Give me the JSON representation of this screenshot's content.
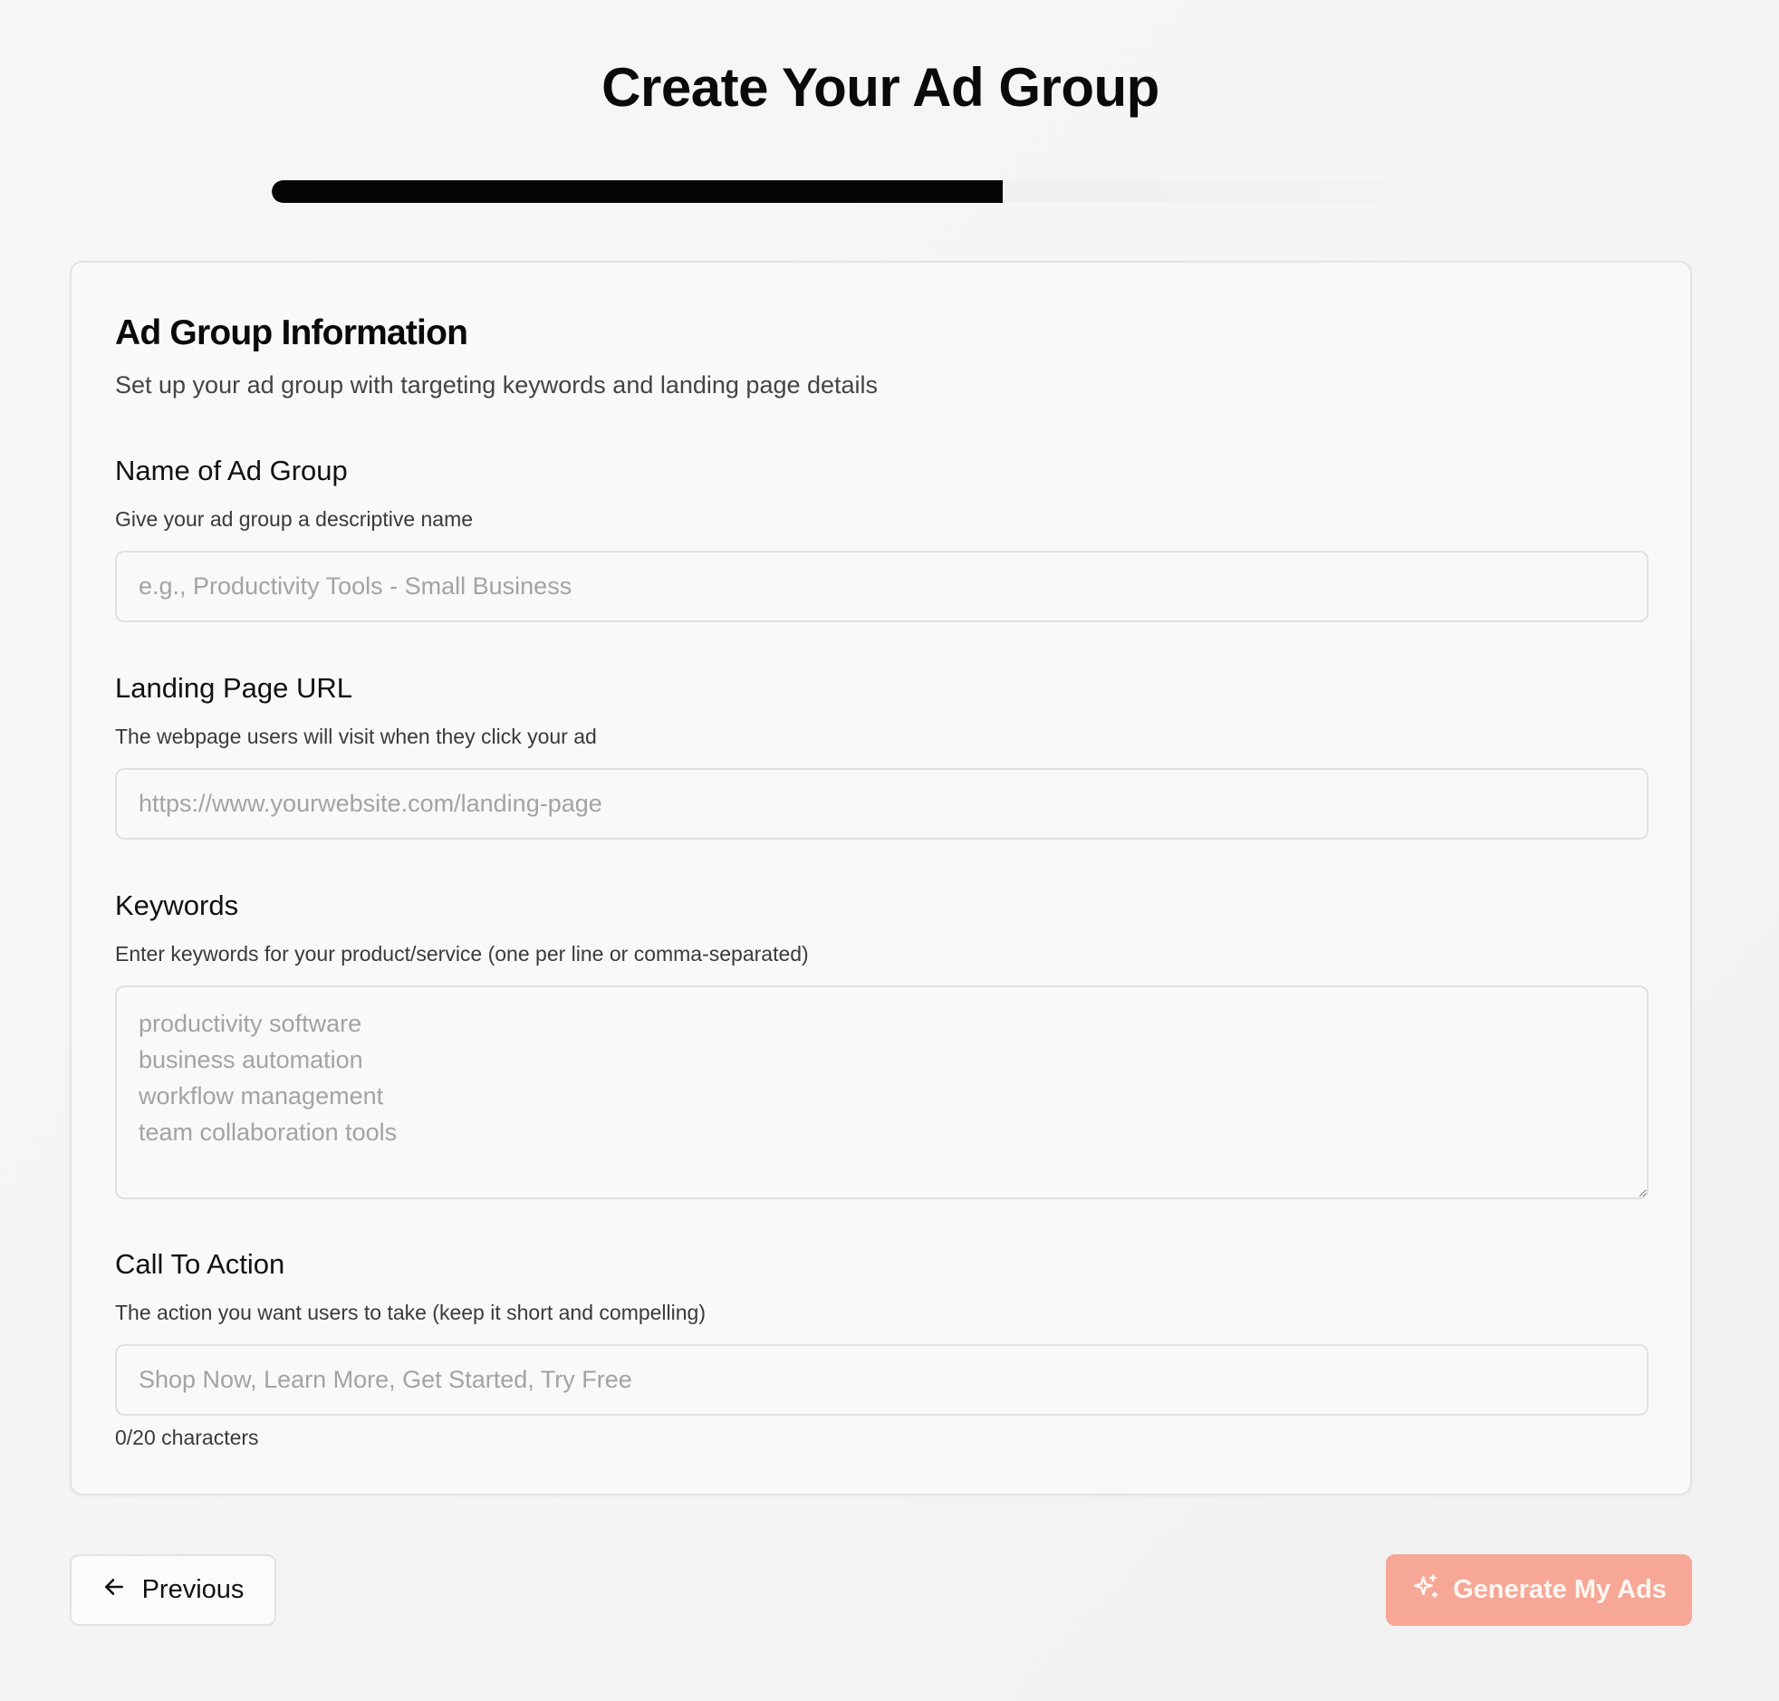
{
  "page": {
    "title": "Create Your Ad Group"
  },
  "progress": {
    "value": 0.6
  },
  "card": {
    "title": "Ad Group Information",
    "subtitle": "Set up your ad group with targeting keywords and landing page details"
  },
  "fields": {
    "name": {
      "label": "Name of Ad Group",
      "help": "Give your ad group a descriptive name",
      "value": "",
      "placeholder": "e.g., Productivity Tools - Small Business"
    },
    "url": {
      "label": "Landing Page URL",
      "help": "The webpage users will visit when they click your ad",
      "value": "",
      "placeholder": "https://www.yourwebsite.com/landing-page"
    },
    "keywords": {
      "label": "Keywords",
      "help": "Enter keywords for your product/service (one per line or comma-separated)",
      "value": "",
      "placeholder": "productivity software\nbusiness automation\nworkflow management\nteam collaboration tools"
    },
    "cta": {
      "label": "Call To Action",
      "help": "The action you want users to take (keep it short and compelling)",
      "value": "",
      "placeholder": "Shop Now, Learn More, Get Started, Try Free",
      "char_count": "0/20 characters"
    }
  },
  "buttons": {
    "previous": {
      "label": "Previous",
      "icon": "arrow-left-icon"
    },
    "generate": {
      "label": "Generate My Ads",
      "icon": "sparkles-icon",
      "disabled": true
    }
  },
  "colors": {
    "accent": "#f6a795",
    "progress_fill": "#050505",
    "progress_track": "#ececec"
  }
}
